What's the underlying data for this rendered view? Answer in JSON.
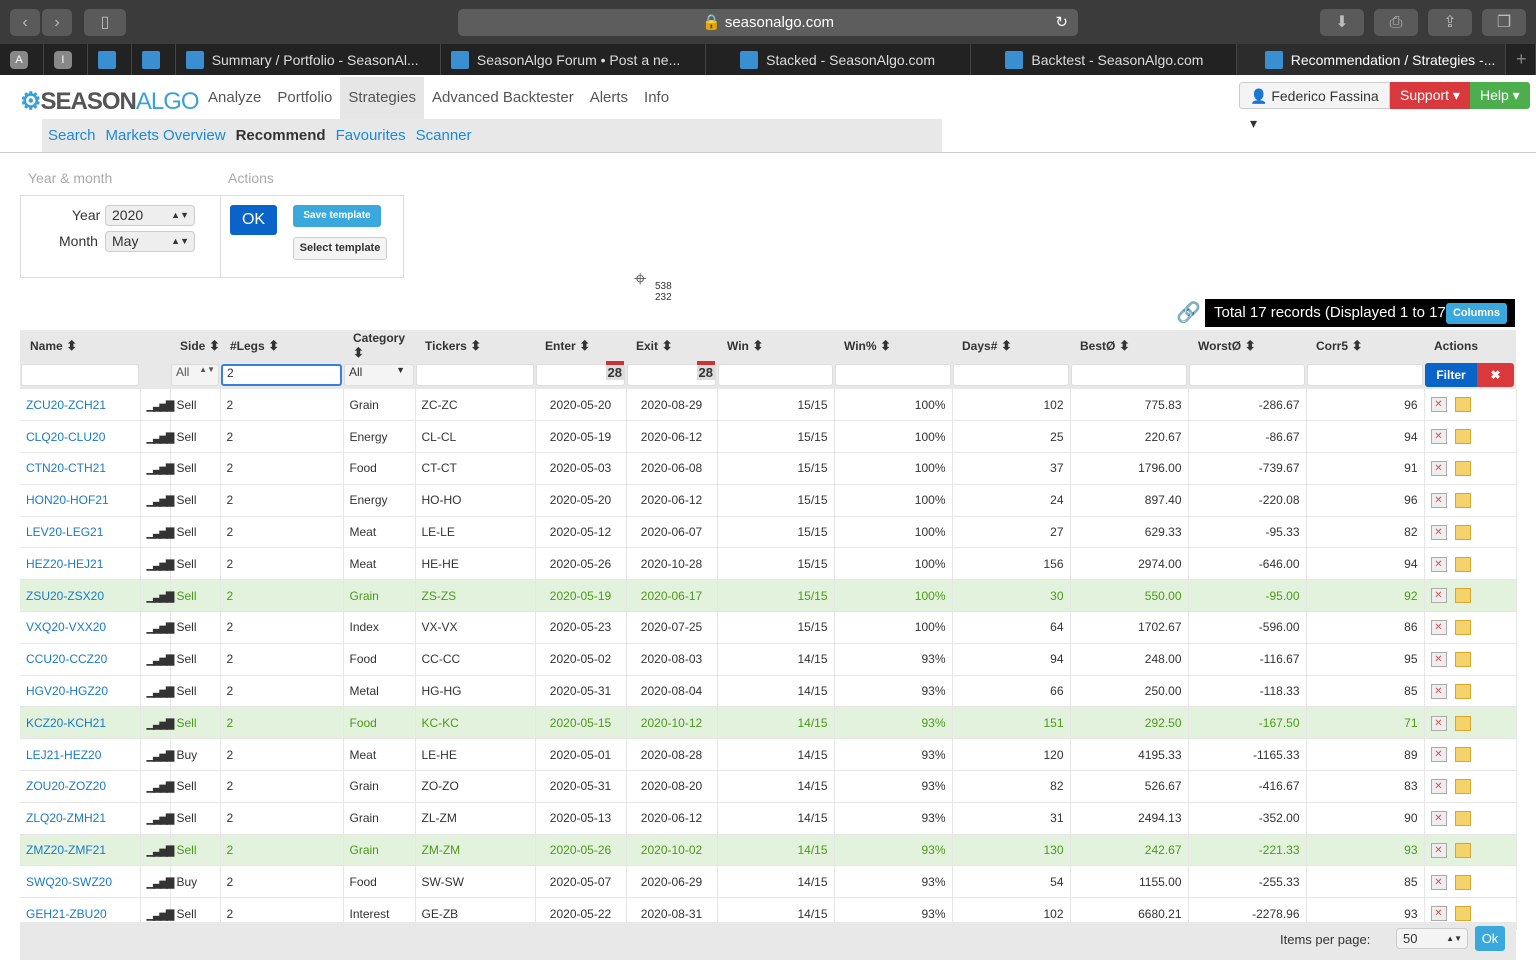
{
  "browser": {
    "url": "seasonalgo.com",
    "pinned": [
      "A",
      "I"
    ],
    "tabs": [
      "Summary / Portfolio - SeasonAl...",
      "SeasonAlgo Forum • Post a ne...",
      "Stacked - SeasonAlgo.com",
      "Backtest - SeasonAlgo.com",
      "Recommendation / Strategies -..."
    ]
  },
  "nav": {
    "logo_a": "SEASON",
    "logo_b": "ALGO",
    "items": [
      "Analyze",
      "Portfolio",
      "Strategies",
      "Advanced Backtester",
      "Alerts",
      "Info"
    ],
    "sub": [
      "Search",
      "Markets Overview",
      "Recommend",
      "Favourites",
      "Scanner"
    ],
    "user": "Federico Fassina",
    "support": "Support",
    "help": "Help"
  },
  "form": {
    "ym_label": "Year & month",
    "actions_label": "Actions",
    "year_label": "Year",
    "year": "2020",
    "month_label": "Month",
    "month": "May",
    "ok": "OK",
    "save_template": "Save template",
    "select_template": "Select template"
  },
  "cursor": {
    "x": "538",
    "y": "232"
  },
  "total": "Total 17 records (Displayed 1 to 17)",
  "columns_btn": "Columns",
  "headers": [
    "Name",
    "",
    "Side",
    "#Legs",
    "Category",
    "Tickers",
    "Enter",
    "Exit",
    "Win",
    "Win%",
    "Days#",
    "BestØ",
    "WorstØ",
    "Corr5",
    "Actions"
  ],
  "filters": {
    "side": "All",
    "legs": "2",
    "category": "All",
    "cal": "28",
    "filter": "Filter"
  },
  "rows": [
    [
      "ZCU20-ZCH21",
      "Sell",
      "2",
      "Grain",
      "ZC-ZC",
      "2020-05-20",
      "2020-08-29",
      "15/15",
      "100%",
      "102",
      "775.83",
      "-286.67",
      "96",
      false
    ],
    [
      "CLQ20-CLU20",
      "Sell",
      "2",
      "Energy",
      "CL-CL",
      "2020-05-19",
      "2020-06-12",
      "15/15",
      "100%",
      "25",
      "220.67",
      "-86.67",
      "94",
      false
    ],
    [
      "CTN20-CTH21",
      "Sell",
      "2",
      "Food",
      "CT-CT",
      "2020-05-03",
      "2020-06-08",
      "15/15",
      "100%",
      "37",
      "1796.00",
      "-739.67",
      "91",
      false
    ],
    [
      "HON20-HOF21",
      "Sell",
      "2",
      "Energy",
      "HO-HO",
      "2020-05-20",
      "2020-06-12",
      "15/15",
      "100%",
      "24",
      "897.40",
      "-220.08",
      "96",
      false
    ],
    [
      "LEV20-LEG21",
      "Sell",
      "2",
      "Meat",
      "LE-LE",
      "2020-05-12",
      "2020-06-07",
      "15/15",
      "100%",
      "27",
      "629.33",
      "-95.33",
      "82",
      false
    ],
    [
      "HEZ20-HEJ21",
      "Sell",
      "2",
      "Meat",
      "HE-HE",
      "2020-05-26",
      "2020-10-28",
      "15/15",
      "100%",
      "156",
      "2974.00",
      "-646.00",
      "94",
      false
    ],
    [
      "ZSU20-ZSX20",
      "Sell",
      "2",
      "Grain",
      "ZS-ZS",
      "2020-05-19",
      "2020-06-17",
      "15/15",
      "100%",
      "30",
      "550.00",
      "-95.00",
      "92",
      true
    ],
    [
      "VXQ20-VXX20",
      "Sell",
      "2",
      "Index",
      "VX-VX",
      "2020-05-23",
      "2020-07-25",
      "15/15",
      "100%",
      "64",
      "1702.67",
      "-596.00",
      "86",
      false
    ],
    [
      "CCU20-CCZ20",
      "Sell",
      "2",
      "Food",
      "CC-CC",
      "2020-05-02",
      "2020-08-03",
      "14/15",
      "93%",
      "94",
      "248.00",
      "-116.67",
      "95",
      false
    ],
    [
      "HGV20-HGZ20",
      "Sell",
      "2",
      "Metal",
      "HG-HG",
      "2020-05-31",
      "2020-08-04",
      "14/15",
      "93%",
      "66",
      "250.00",
      "-118.33",
      "85",
      false
    ],
    [
      "KCZ20-KCH21",
      "Sell",
      "2",
      "Food",
      "KC-KC",
      "2020-05-15",
      "2020-10-12",
      "14/15",
      "93%",
      "151",
      "292.50",
      "-167.50",
      "71",
      true
    ],
    [
      "LEJ21-HEZ20",
      "Buy",
      "2",
      "Meat",
      "LE-HE",
      "2020-05-01",
      "2020-08-28",
      "14/15",
      "93%",
      "120",
      "4195.33",
      "-1165.33",
      "89",
      false
    ],
    [
      "ZOU20-ZOZ20",
      "Sell",
      "2",
      "Grain",
      "ZO-ZO",
      "2020-05-31",
      "2020-08-20",
      "14/15",
      "93%",
      "82",
      "526.67",
      "-416.67",
      "83",
      false
    ],
    [
      "ZLQ20-ZMH21",
      "Sell",
      "2",
      "Grain",
      "ZL-ZM",
      "2020-05-13",
      "2020-06-12",
      "14/15",
      "93%",
      "31",
      "2494.13",
      "-352.00",
      "90",
      false
    ],
    [
      "ZMZ20-ZMF21",
      "Sell",
      "2",
      "Grain",
      "ZM-ZM",
      "2020-05-26",
      "2020-10-02",
      "14/15",
      "93%",
      "130",
      "242.67",
      "-221.33",
      "93",
      true
    ],
    [
      "SWQ20-SWZ20",
      "Buy",
      "2",
      "Food",
      "SW-SW",
      "2020-05-07",
      "2020-06-29",
      "14/15",
      "93%",
      "54",
      "1155.00",
      "-255.33",
      "85",
      false
    ],
    [
      "GEH21-ZBU20",
      "Sell",
      "2",
      "Interest",
      "GE-ZB",
      "2020-05-22",
      "2020-08-31",
      "14/15",
      "93%",
      "102",
      "6680.21",
      "-2278.96",
      "93",
      false
    ]
  ],
  "footer": {
    "ipp_label": "Items per page:",
    "ipp": "50",
    "ok": "Ok"
  },
  "colors": {
    "link": "#1a7ac8",
    "highlight_bg": "#e3f2dc",
    "highlight_text": "#4a9a1a",
    "support": "#d9393c",
    "help": "#4cae4c",
    "primary": "#0a63c9"
  }
}
